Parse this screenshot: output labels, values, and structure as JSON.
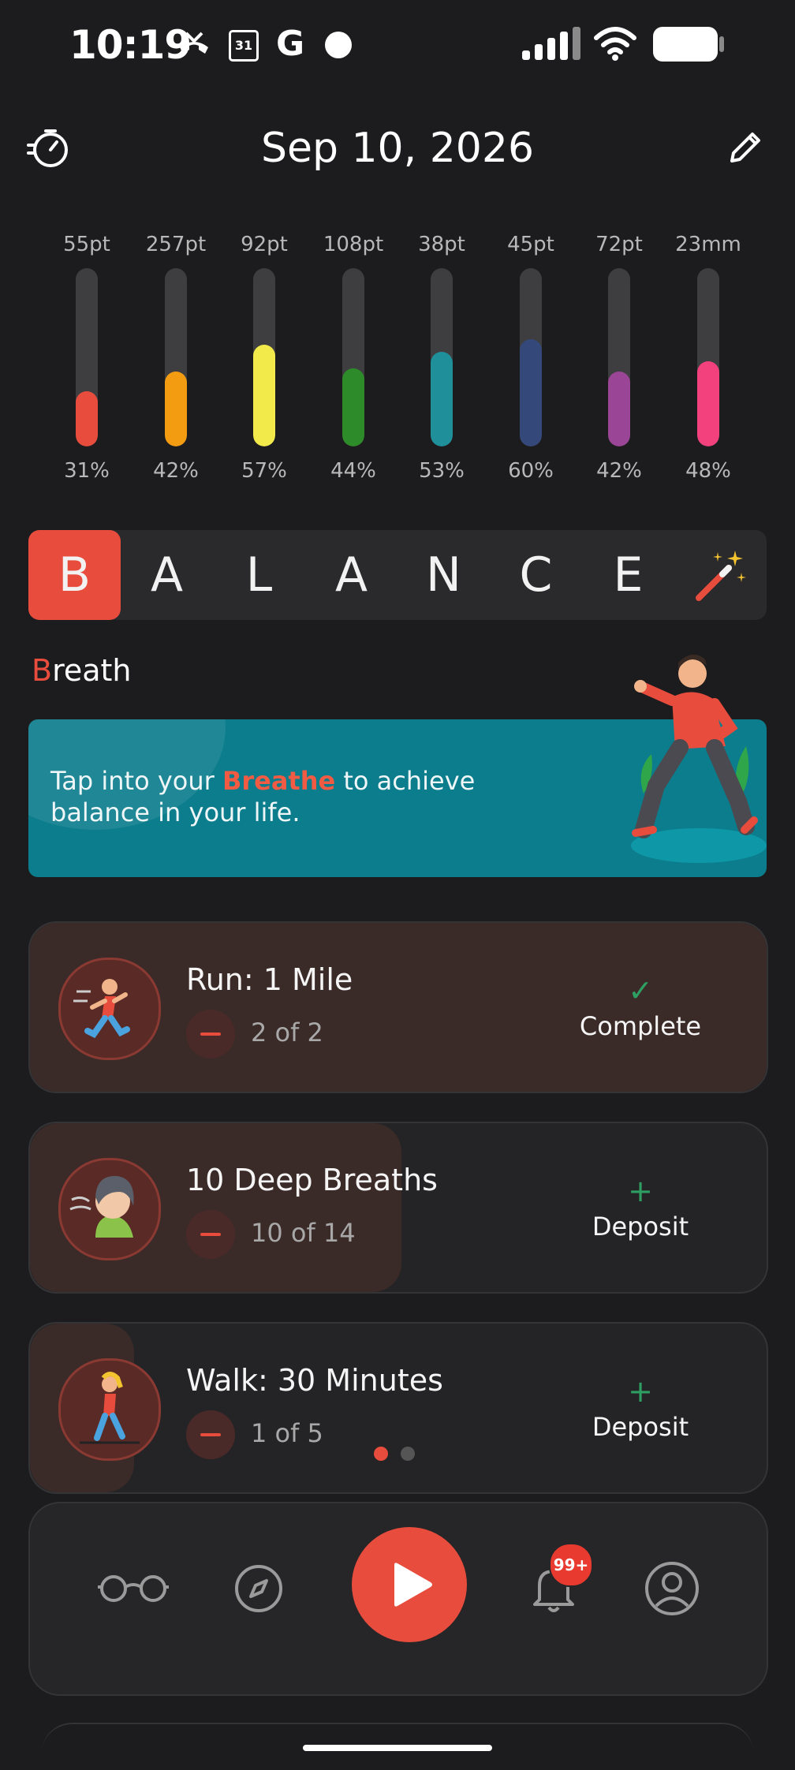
{
  "status_bar": {
    "time": "10:19",
    "icons": [
      "missed-call-icon",
      "calendar-icon",
      "google-icon",
      "dot-icon",
      "signal-icon",
      "wifi-icon",
      "battery-icon"
    ],
    "calendar_day": "31",
    "google_letter": "G"
  },
  "header": {
    "date": "Sep 10, 2026",
    "left_icon": "timer-icon",
    "right_icon": "pencil-icon"
  },
  "metrics": [
    {
      "top": "55pt",
      "percent": "31%",
      "fill": 0.31,
      "color": "#e84c3d"
    },
    {
      "top": "257pt",
      "percent": "42%",
      "fill": 0.42,
      "color": "#f39c12"
    },
    {
      "top": "92pt",
      "percent": "57%",
      "fill": 0.57,
      "color": "#f2ea4a"
    },
    {
      "top": "108pt",
      "percent": "44%",
      "fill": 0.44,
      "color": "#2e8b2a"
    },
    {
      "top": "38pt",
      "percent": "53%",
      "fill": 0.53,
      "color": "#1f8f9a"
    },
    {
      "top": "45pt",
      "percent": "60%",
      "fill": 0.6,
      "color": "#34497a"
    },
    {
      "top": "72pt",
      "percent": "42%",
      "fill": 0.42,
      "color": "#9a4595"
    },
    {
      "top": "23mm",
      "percent": "48%",
      "fill": 0.48,
      "color": "#f2417d"
    }
  ],
  "balance": {
    "letters": [
      "B",
      "A",
      "L",
      "A",
      "N",
      "C",
      "E"
    ],
    "active_index": 0,
    "magic_icon": "magic-wand-icon"
  },
  "section": {
    "first_letter": "B",
    "rest": "reath"
  },
  "banner": {
    "text_before": "Tap into your ",
    "highlight": "Breathe",
    "text_after": " to achieve balance in your life."
  },
  "activities": [
    {
      "title": "Run: 1 Mile",
      "count": "2 of 2",
      "progress": 1.0,
      "action_icon": "checkmark-icon",
      "action_symbol": "✓",
      "action_label": "Complete",
      "avatar_icon": "runner-icon"
    },
    {
      "title": "10 Deep Breaths",
      "count": "10 of 14",
      "progress": 0.714,
      "action_icon": "plus-icon",
      "action_symbol": "+",
      "action_label": "Deposit",
      "avatar_icon": "breathing-person-icon"
    },
    {
      "title": "Walk: 30 Minutes",
      "count": "1 of 5",
      "progress": 0.2,
      "action_icon": "plus-icon",
      "action_symbol": "+",
      "action_label": "Deposit",
      "avatar_icon": "walker-icon"
    }
  ],
  "pager": {
    "total": 2,
    "active": 0
  },
  "nav": {
    "items": [
      "glasses-icon",
      "compass-icon",
      "play-icon",
      "bell-icon",
      "profile-icon"
    ],
    "badge": "99+"
  },
  "colors": {
    "accent": "#e84c3d",
    "background": "#1c1c1e",
    "banner": "#0c7d8c",
    "success": "#2f9e62"
  }
}
